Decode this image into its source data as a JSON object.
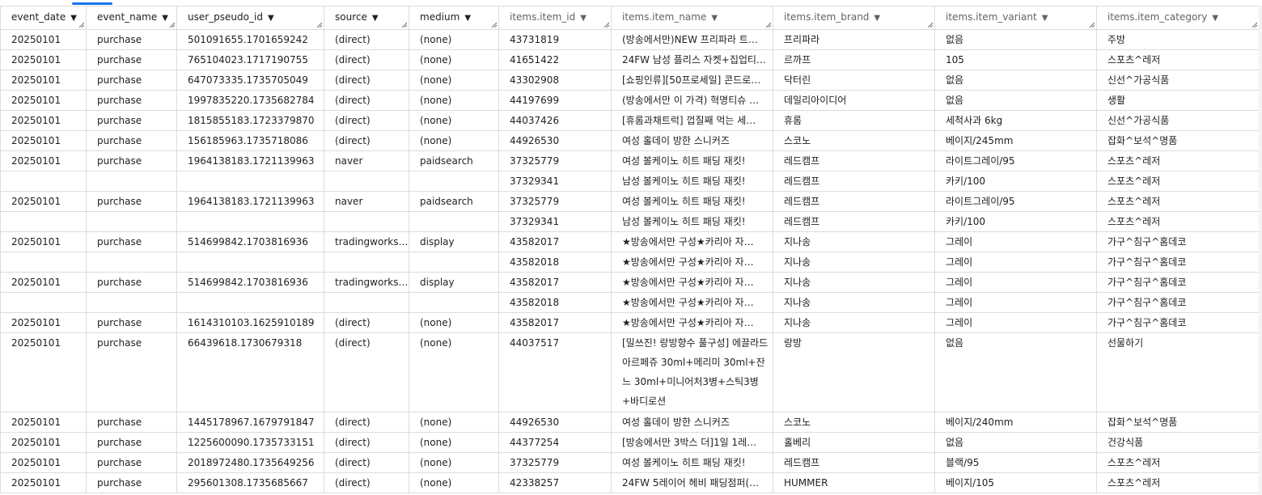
{
  "columns": [
    {
      "label": "event_date",
      "dim": false
    },
    {
      "label": "event_name",
      "dim": false
    },
    {
      "label": "user_pseudo_id",
      "dim": false
    },
    {
      "label": "source",
      "dim": false
    },
    {
      "label": "medium",
      "dim": false
    },
    {
      "label": "items.item_id",
      "dim": true
    },
    {
      "label": "items.item_name",
      "dim": true
    },
    {
      "label": "items.item_brand",
      "dim": true
    },
    {
      "label": "items.item_variant",
      "dim": true
    },
    {
      "label": "items.item_category",
      "dim": true
    }
  ],
  "sort_icon": "triangle-down-icon",
  "rows": [
    [
      "20250101",
      "purchase",
      "501091655.1701659242",
      "(direct)",
      "(none)",
      "43731819",
      "(방송에서만)NEW 프리파라 트…",
      "프리파라",
      "없음",
      "주방"
    ],
    [
      "20250101",
      "purchase",
      "765104023.1717190755",
      "(direct)",
      "(none)",
      "41651422",
      "24FW 남성 플리스 자켓+집업티…",
      "르까프",
      "105",
      "스포츠^레저"
    ],
    [
      "20250101",
      "purchase",
      "647073335.1735705049",
      "(direct)",
      "(none)",
      "43302908",
      "[쇼핑인류][50프로세일] 콘드로…",
      "닥터린",
      "없음",
      "신선^가공식품"
    ],
    [
      "20250101",
      "purchase",
      "1997835220.1735682784",
      "(direct)",
      "(none)",
      "44197699",
      "(방송에서만 이 가격) 혁명티슈 …",
      "데일리아이디어",
      "없음",
      "생활"
    ],
    [
      "20250101",
      "purchase",
      "1815855183.1723379870",
      "(direct)",
      "(none)",
      "44037426",
      "[휴롬과채트럭] 껍질째 먹는 세…",
      "휴롬",
      "세척사과 6kg",
      "신선^가공식품"
    ],
    [
      "20250101",
      "purchase",
      "156185963.1735718086",
      "(direct)",
      "(none)",
      "44926530",
      "여성 홀데이 방한 스니커즈",
      "스코노",
      "베이지/245mm",
      "잡화^보석^명품"
    ],
    [
      "20250101",
      "purchase",
      "1964138183.1721139963",
      "naver",
      "paidsearch",
      "37325779",
      "여성 볼케이노 히트 패딩 재킷!",
      "레드캠프",
      "라이트그레이/95",
      "스포츠^레저"
    ],
    [
      "",
      "",
      "",
      "",
      "",
      "37329341",
      "남성 볼케이노 히트 패딩 재킷!",
      "레드캠프",
      "카키/100",
      "스포츠^레저"
    ],
    [
      "20250101",
      "purchase",
      "1964138183.1721139963",
      "naver",
      "paidsearch",
      "37325779",
      "여성 볼케이노 히트 패딩 재킷!",
      "레드캠프",
      "라이트그레이/95",
      "스포츠^레저"
    ],
    [
      "",
      "",
      "",
      "",
      "",
      "37329341",
      "남성 볼케이노 히트 패딩 재킷!",
      "레드캠프",
      "카키/100",
      "스포츠^레저"
    ],
    [
      "20250101",
      "purchase",
      "514699842.1703816936",
      "tradingworks…",
      "display",
      "43582017",
      "★방송에서만 구성★카리아 자…",
      "지나송",
      "그레이",
      "가구^침구^홈데코"
    ],
    [
      "",
      "",
      "",
      "",
      "",
      "43582018",
      "★방송에서만 구성★카리아 자…",
      "지나송",
      "그레이",
      "가구^침구^홈데코"
    ],
    [
      "20250101",
      "purchase",
      "514699842.1703816936",
      "tradingworks…",
      "display",
      "43582017",
      "★방송에서만 구성★카리아 자…",
      "지나송",
      "그레이",
      "가구^침구^홈데코"
    ],
    [
      "",
      "",
      "",
      "",
      "",
      "43582018",
      "★방송에서만 구성★카리아 자…",
      "지나송",
      "그레이",
      "가구^침구^홈데코"
    ],
    [
      "20250101",
      "purchase",
      "1614310103.1625910189",
      "(direct)",
      "(none)",
      "43582017",
      "★방송에서만 구성★카리아 자…",
      "지나송",
      "그레이",
      "가구^침구^홈데코"
    ],
    [
      "20250101",
      "purchase",
      "66439618.1730679318",
      "(direct)",
      "(none)",
      "44037517",
      "[밀쓰진! 랑방향수 풀구성] 에끌라드 아르페쥬 30ml+메리미 30ml+잔느 30ml+미니어처3병+스틱3병+바디로션",
      "랑방",
      "없음",
      "선물하기"
    ],
    [
      "20250101",
      "purchase",
      "1445178967.1679791847",
      "(direct)",
      "(none)",
      "44926530",
      "여성 홀데이 방한 스니커즈",
      "스코노",
      "베이지/240mm",
      "잡화^보석^명품"
    ],
    [
      "20250101",
      "purchase",
      "1225600090.1735733151",
      "(direct)",
      "(none)",
      "44377254",
      "[방송에서만 3박스 더]1일 1레…",
      "홀베리",
      "없음",
      "건강식품"
    ],
    [
      "20250101",
      "purchase",
      "2018972480.1735649256",
      "(direct)",
      "(none)",
      "37325779",
      "여성 볼케이노 히트 패딩 재킷!",
      "레드캠프",
      "블랙/95",
      "스포츠^레저"
    ],
    [
      "20250101",
      "purchase",
      "295601308.1735685667",
      "(direct)",
      "(none)",
      "42338257",
      "24FW 5레이어 헤비 패딩점퍼(…",
      "HUMMER",
      "베이지/105",
      "스포츠^레저"
    ]
  ]
}
